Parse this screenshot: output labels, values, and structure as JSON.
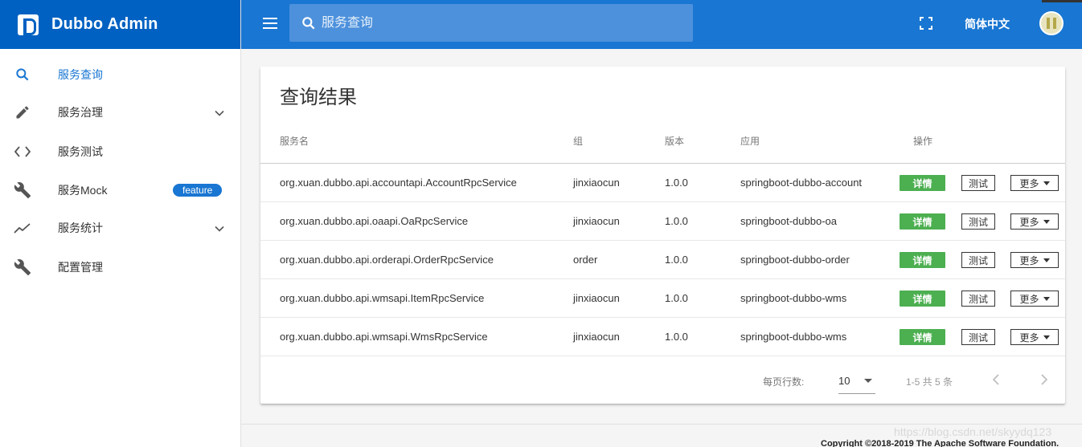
{
  "brand": {
    "title": "Dubbo Admin"
  },
  "sidebar": {
    "items": [
      {
        "label": "服务查询",
        "icon": "search-icon",
        "active": true
      },
      {
        "label": "服务治理",
        "icon": "pencil-icon",
        "expandable": true
      },
      {
        "label": "服务测试",
        "icon": "code-icon"
      },
      {
        "label": "服务Mock",
        "icon": "wrench-icon",
        "badge": "feature"
      },
      {
        "label": "服务统计",
        "icon": "trending-icon",
        "expandable": true
      },
      {
        "label": "配置管理",
        "icon": "wrench-icon"
      }
    ]
  },
  "topbar": {
    "search_placeholder": "服务查询",
    "language": "简体中文"
  },
  "results": {
    "title": "查询结果",
    "columns": [
      "服务名",
      "组",
      "版本",
      "应用",
      "操作"
    ],
    "rows": [
      {
        "service": "org.xuan.dubbo.api.accountapi.AccountRpcService",
        "group": "jinxiaocun",
        "version": "1.0.0",
        "app": "springboot-dubbo-account"
      },
      {
        "service": "org.xuan.dubbo.api.oaapi.OaRpcService",
        "group": "jinxiaocun",
        "version": "1.0.0",
        "app": "springboot-dubbo-oa"
      },
      {
        "service": "org.xuan.dubbo.api.orderapi.OrderRpcService",
        "group": "order",
        "version": "1.0.0",
        "app": "springboot-dubbo-order"
      },
      {
        "service": "org.xuan.dubbo.api.wmsapi.ItemRpcService",
        "group": "jinxiaocun",
        "version": "1.0.0",
        "app": "springboot-dubbo-wms"
      },
      {
        "service": "org.xuan.dubbo.api.wmsapi.WmsRpcService",
        "group": "jinxiaocun",
        "version": "1.0.0",
        "app": "springboot-dubbo-wms"
      }
    ],
    "actions": {
      "detail": "详情",
      "test": "测试",
      "more": "更多"
    }
  },
  "pagination": {
    "rows_per_page_label": "每页行数:",
    "rows_per_page": "10",
    "range": "1-5 共 5 条"
  },
  "footer": {
    "copyright": "Copyright ©2018-2019 The Apache Software Foundation."
  },
  "watermark": "https://blog.csdn.net/skyydq123",
  "colors": {
    "primary": "#1976d2",
    "brand_dark": "#0061c2",
    "success": "#4caf50"
  }
}
